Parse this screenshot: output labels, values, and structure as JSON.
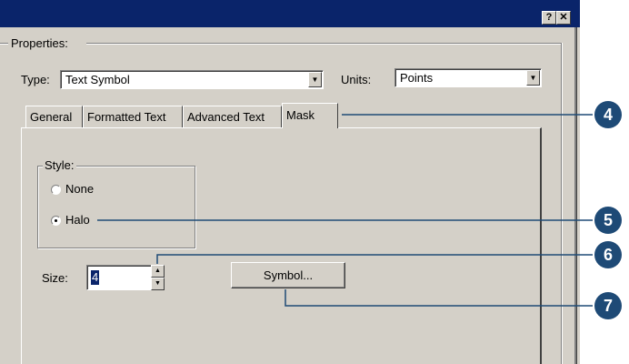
{
  "title_buttons": {
    "help": "?",
    "close": "✕"
  },
  "group_title": "Properties:",
  "type_label": "Type:",
  "type_value": "Text Symbol",
  "units_label": "Units:",
  "units_value": "Points",
  "tabs": [
    {
      "label": "General"
    },
    {
      "label": "Formatted Text"
    },
    {
      "label": "Advanced Text"
    },
    {
      "label": "Mask"
    }
  ],
  "style_group": {
    "title": "Style:",
    "none_label": "None",
    "halo_label": "Halo",
    "selected": "Halo"
  },
  "size_label": "Size:",
  "size_value": "4",
  "symbol_button": "Symbol...",
  "callouts": [
    "4",
    "5",
    "6",
    "7"
  ],
  "colors": {
    "callout": "#1e4a76",
    "title_bar": "#0a246a",
    "dialog": "#d4d0c8"
  }
}
